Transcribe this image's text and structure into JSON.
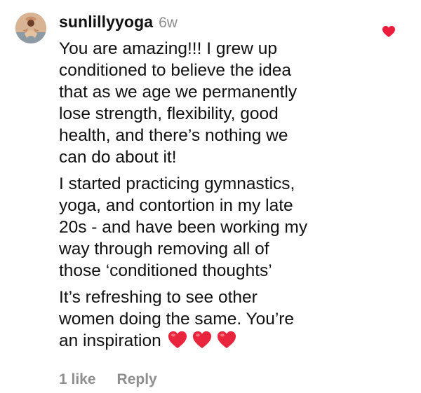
{
  "comment": {
    "username": "sunlillyyoga",
    "time": "6w",
    "paragraphs": [
      "You are amazing!!! I grew up\nconditioned to believe the idea\nthat as we age we permanently\nlose strength, flexibility, good\nhealth, and there’s nothing we\ncan do about it!",
      "I started practicing gymnastics,\nyoga, and contortion in my late\n20s - and have been working my\nway through removing all of\nthose ‘conditioned thoughts’",
      "It’s refreshing to see other\nwomen doing the same. You’re\nan inspiration"
    ],
    "emoji_count": 3,
    "likes_label": "1 like",
    "reply_label": "Reply",
    "liked": true
  },
  "colors": {
    "heart": "#ed1c3c",
    "secondary_text": "#8e8e8e",
    "primary_text": "#111111"
  },
  "icons": {
    "like": "heart-filled-icon",
    "emoji": "red-heart-emoji"
  }
}
